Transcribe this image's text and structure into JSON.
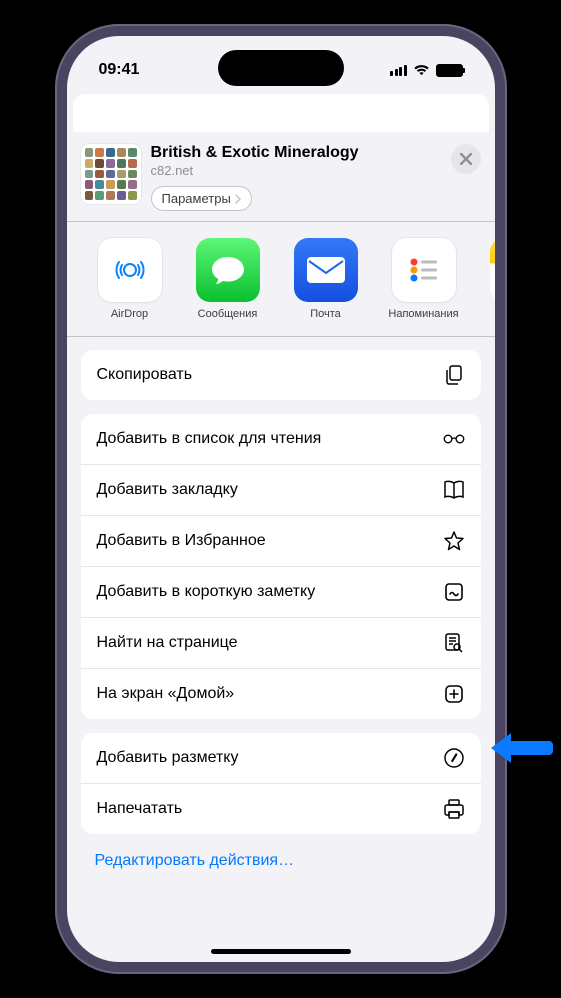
{
  "statusBar": {
    "time": "09:41"
  },
  "header": {
    "title": "British & Exotic Mineralogy",
    "subtitle": "c82.net",
    "optionsLabel": "Параметры"
  },
  "apps": [
    {
      "name": "AirDrop"
    },
    {
      "name": "Сообщения"
    },
    {
      "name": "Почта"
    },
    {
      "name": "Напоминания"
    }
  ],
  "actions": {
    "g1": [
      {
        "label": "Скопировать",
        "icon": "copy-icon"
      }
    ],
    "g2": [
      {
        "label": "Добавить в список для чтения",
        "icon": "glasses-icon"
      },
      {
        "label": "Добавить закладку",
        "icon": "book-icon"
      },
      {
        "label": "Добавить в Избранное",
        "icon": "star-icon"
      },
      {
        "label": "Добавить в короткую заметку",
        "icon": "quicknote-icon"
      },
      {
        "label": "Найти на странице",
        "icon": "findpage-icon"
      },
      {
        "label": "На экран «Домой»",
        "icon": "addhome-icon"
      }
    ],
    "g3": [
      {
        "label": "Добавить разметку",
        "icon": "markup-icon"
      },
      {
        "label": "Напечатать",
        "icon": "print-icon"
      }
    ]
  },
  "editActions": "Редактировать действия…"
}
